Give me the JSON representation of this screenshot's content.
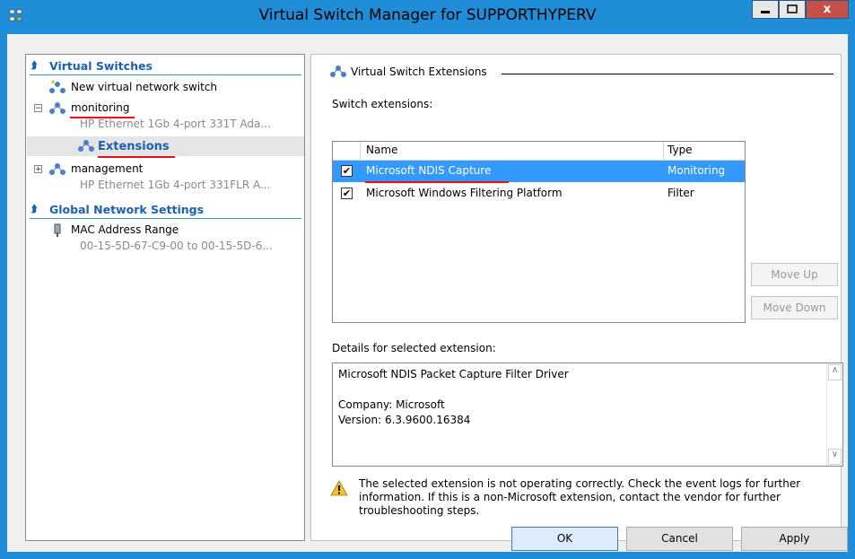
{
  "window": {
    "title": "Virtual Switch Manager for SUPPORTHYPERV",
    "close_label": "x"
  },
  "tree": {
    "virtual_switches_header": "Virtual Switches",
    "new_switch": "New virtual network switch",
    "monitoring": {
      "label": "monitoring",
      "adapter": "HP Ethernet 1Gb 4-port 331T Ada...",
      "expander": "−"
    },
    "extensions": "Extensions",
    "management": {
      "label": "management",
      "adapter": "HP Ethernet 1Gb 4-port 331FLR A...",
      "expander": "+"
    },
    "global_header": "Global Network Settings",
    "mac": {
      "label": "MAC Address Range",
      "range": "00-15-5D-67-C9-00 to 00-15-5D-6..."
    }
  },
  "pane": {
    "group_title": "Virtual Switch Extensions",
    "switch_extensions_label": "Switch extensions:",
    "columns": {
      "name": "Name",
      "type": "Type"
    },
    "rows": [
      {
        "checked": "✔",
        "name": "Microsoft NDIS Capture",
        "type": "Monitoring",
        "selected": true
      },
      {
        "checked": "✔",
        "name": "Microsoft Windows Filtering Platform",
        "type": "Filter",
        "selected": false
      }
    ],
    "move_up": "Move Up",
    "move_down": "Move Down",
    "details_label": "Details for selected extension:",
    "details": {
      "title": "Microsoft NDIS Packet Capture Filter Driver",
      "company": "Company: Microsoft",
      "version": "Version: 6.3.9600.16384"
    },
    "warning": "The selected extension is not operating correctly. Check the event logs for further information. If this is a non-Microsoft extension, contact the vendor for further troubleshooting steps."
  },
  "footer": {
    "ok": "OK",
    "cancel": "Cancel",
    "apply": "Apply"
  },
  "colors": {
    "titlebar": "#1f8dd8",
    "accent": "#1d5fb0",
    "selection": "#3399ff",
    "annotation": "#ee1111"
  }
}
